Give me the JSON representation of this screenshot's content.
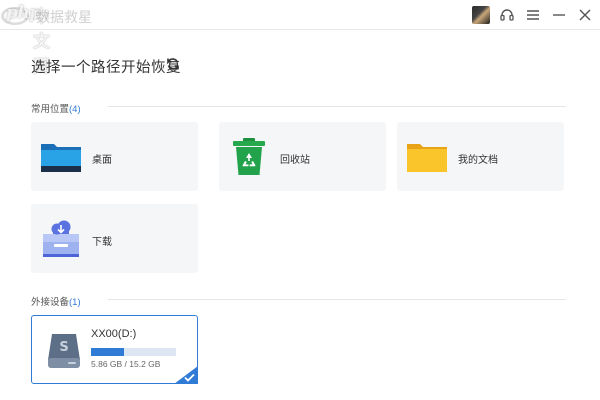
{
  "watermark": {
    "text": "php",
    "cn": "中文网"
  },
  "app": {
    "title": "数据救星"
  },
  "header": {
    "title": "选择一个路径开始恢复"
  },
  "sections": {
    "common": {
      "label": "常用位置",
      "count": "(4)"
    },
    "external": {
      "label": "外接设备",
      "count": "(1)"
    }
  },
  "locations": [
    {
      "label": "桌面",
      "icon": "desktop-folder-icon"
    },
    {
      "label": "回收站",
      "icon": "recycle-bin-icon"
    },
    {
      "label": "我的文档",
      "icon": "documents-folder-icon"
    },
    {
      "label": "下载",
      "icon": "download-tray-icon"
    }
  ],
  "drive": {
    "name": "XX00(D:)",
    "size_text": "5.86 GB / 15.2 GB",
    "used_fraction": 0.386,
    "icon": "hard-drive-icon",
    "selected": true
  },
  "colors": {
    "accent": "#2f7bd6",
    "card_bg": "#f5f6f8",
    "recycle_green": "#22a24a",
    "folder_yellow": "#f7bd21",
    "folder_blue": "#1e88d6"
  },
  "window_controls": [
    "avatar",
    "headset-icon",
    "menu-icon",
    "minimize-icon",
    "close-icon"
  ]
}
